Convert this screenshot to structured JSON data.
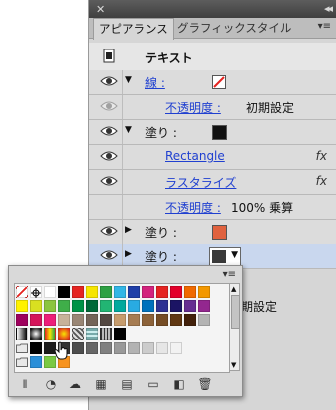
{
  "panel": {
    "tabs": [
      "アピアランス",
      "グラフィックスタイル"
    ],
    "rows": [
      {
        "kind": "head",
        "label": "テキスト"
      },
      {
        "kind": "stroke",
        "label": "線 :"
      },
      {
        "kind": "opacity",
        "label": "不透明度 :",
        "value": "初期設定"
      },
      {
        "kind": "fill",
        "label": "塗り :"
      },
      {
        "kind": "effect",
        "label": "Rectangle",
        "fx": "fx"
      },
      {
        "kind": "effect",
        "label": "ラスタライズ",
        "fx": "fx"
      },
      {
        "kind": "opacity",
        "label": "不透明度 :",
        "value": "100% 乗算"
      },
      {
        "kind": "fill",
        "label": "塗り :"
      },
      {
        "kind": "fill",
        "label": "塗り :"
      }
    ],
    "partial_text": "期設定"
  },
  "colors": {
    "fill_black": "#111111",
    "fill_orange": "#e0623f",
    "fill_dark": "#3a3a3a",
    "selection": "#c9d7ee"
  },
  "swatch_rows": [
    [
      "none",
      "registration",
      "#ffffff",
      "#000000",
      "#e52421",
      "#f6e500",
      "#2ea043",
      "#32b6e6",
      "#1f3fa8",
      "#d3237d",
      "#e52421",
      "#e3002b",
      "#f06a00",
      "#f39800"
    ],
    [
      "#fff200",
      "#d9e021",
      "#8bc53f",
      "#3fae49",
      "#009245",
      "#006837",
      "#22b573",
      "#00a99d",
      "#29abe2",
      "#0071bc",
      "#2e3192",
      "#1b1464",
      "#662d91",
      "#93278f"
    ],
    [
      "#9e005d",
      "#d4145a",
      "#ed1e79",
      "#c7b299",
      "#998675",
      "#736357",
      "#534741",
      "#c69c6d",
      "#a67c52",
      "#8c6239",
      "#754c24",
      "#603813",
      "#42210b",
      "#b3b3b3"
    ],
    [
      "grad1",
      "grad2",
      "grad3",
      "grad4",
      "grad5",
      "grad6",
      "grad7",
      "#000000"
    ],
    [
      "folder",
      "#000000",
      "#1a1a1a",
      "#333333",
      "#4d4d4d",
      "#666666",
      "#808080",
      "#999999",
      "#b3b3b3",
      "#cccccc",
      "#e6e6e6",
      "#f2f2f2"
    ],
    [
      "folder",
      "#2b8fd8",
      "#7ac943",
      "#f7931e"
    ]
  ],
  "icons": [
    "swatch-library-icon",
    "swatch-kind-icon",
    "cloud-icon",
    "swatch-options-icon",
    "new-group-icon",
    "folder-icon",
    "new-swatch-icon",
    "trash-icon"
  ]
}
